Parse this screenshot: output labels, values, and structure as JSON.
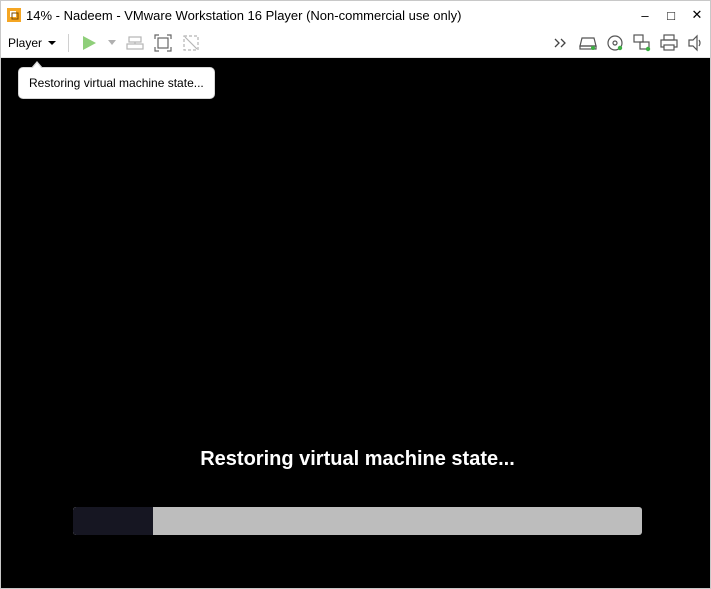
{
  "window": {
    "title": "14% - Nadeem - VMware Workstation 16 Player (Non-commercial use only)",
    "controls": {
      "minimize": "–",
      "maximize": "□",
      "close": "✕"
    }
  },
  "toolbar": {
    "player_menu_label": "Player",
    "left_icons": [
      "play-icon",
      "dropdown-caret-icon",
      "send-ctrl-alt-del-icon",
      "fit-guest-icon",
      "unity-icon"
    ],
    "right_icons": [
      "more-icon",
      "hard-disk-icon",
      "cd-dvd-icon",
      "network-adapter-icon",
      "printer-icon",
      "sound-card-icon"
    ]
  },
  "tooltip": {
    "text": "Restoring virtual machine state..."
  },
  "vm_screen": {
    "status_message": "Restoring virtual machine state...",
    "progress_fraction": 0.14
  },
  "colors": {
    "screen_bg": "#000000",
    "progress_track": "#bdbdbd",
    "progress_fill": "#161622",
    "play_green": "#8fcf7a",
    "icon_gray": "#555555"
  }
}
